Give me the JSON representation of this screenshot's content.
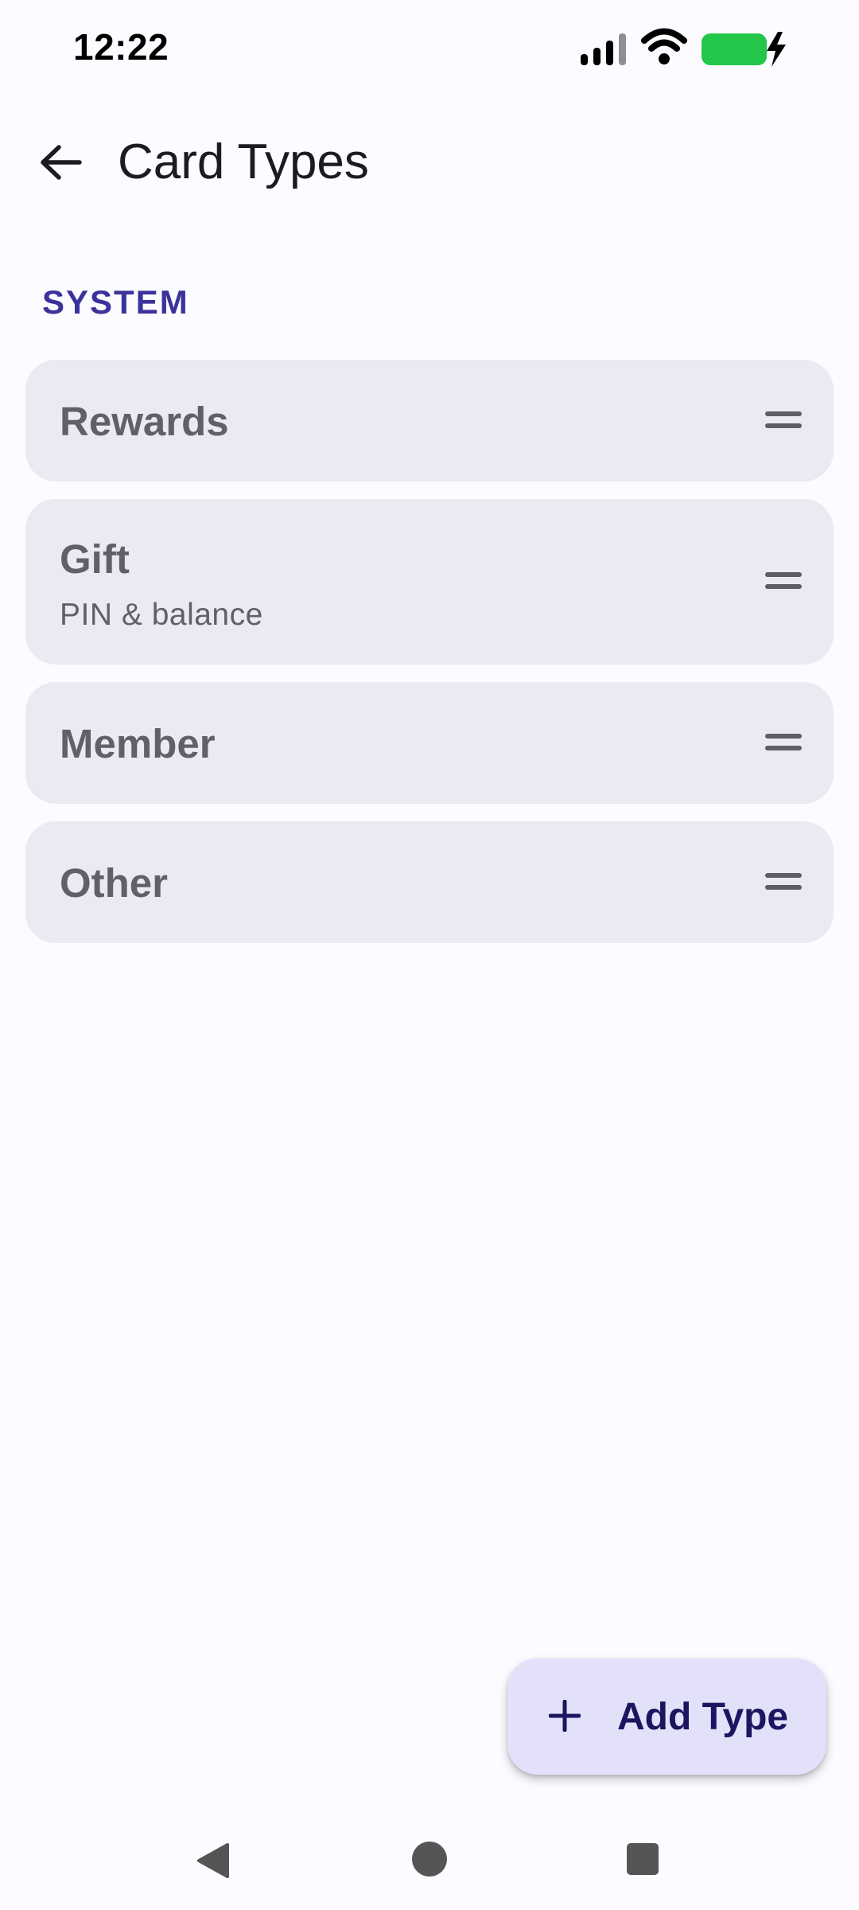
{
  "status_bar": {
    "time": "12:22",
    "icons": [
      "signal-icon",
      "wifi-icon",
      "battery-charging-icon"
    ],
    "battery_color": "#22c74a"
  },
  "app_bar": {
    "back_icon": "arrow-back-icon",
    "title": "Card Types"
  },
  "section": {
    "header": "SYSTEM",
    "header_color": "#3b329b"
  },
  "card_types": [
    {
      "label": "Rewards",
      "sublabel": ""
    },
    {
      "label": "Gift",
      "sublabel": "PIN & balance"
    },
    {
      "label": "Member",
      "sublabel": ""
    },
    {
      "label": "Other",
      "sublabel": ""
    }
  ],
  "fab": {
    "icon": "plus-icon",
    "label": "Add Type",
    "background": "#e3e1f9"
  },
  "nav_bar": {
    "icons": [
      "nav-back-icon",
      "nav-home-icon",
      "nav-recents-icon"
    ]
  }
}
